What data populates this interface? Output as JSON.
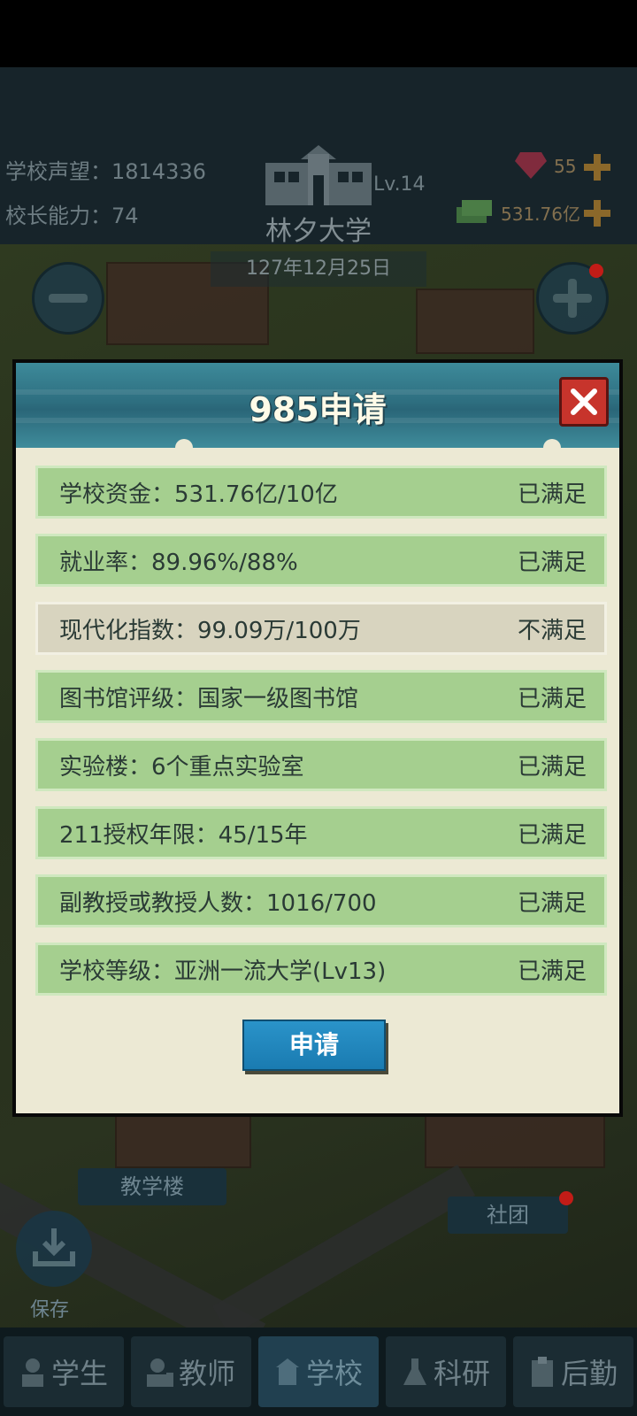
{
  "hud": {
    "prestige": "学校声望：1814336",
    "ability": "校长能力：74",
    "level": "Lv.14",
    "school_name": "林夕大学",
    "gems": "55",
    "money": "531.76亿",
    "date": "127年12月25日"
  },
  "dialog": {
    "title": "985申请",
    "rows": [
      {
        "label": "学校资金：531.76亿/10亿",
        "status": "已满足"
      },
      {
        "label": "就业率：89.96%/88%",
        "status": "已满足"
      },
      {
        "label": "现代化指数：99.09万/100万",
        "status": "不满足"
      },
      {
        "label": "图书馆评级：国家一级图书馆",
        "status": "已满足"
      },
      {
        "label": "实验楼：6个重点实验室",
        "status": "已满足"
      },
      {
        "label": "211授权年限：45/15年",
        "status": "已满足"
      },
      {
        "label": "副教授或教授人数：1016/700",
        "status": "已满足"
      },
      {
        "label": "学校等级：亚洲一流大学(Lv13)",
        "status": "已满足"
      }
    ],
    "apply_label": "申请"
  },
  "map": {
    "teaching_building": "教学楼",
    "club": "社团",
    "save": "保存"
  },
  "nav": {
    "tabs": [
      {
        "label": "学生",
        "icon": "student-icon"
      },
      {
        "label": "教师",
        "icon": "teacher-icon"
      },
      {
        "label": "学校",
        "icon": "school-icon"
      },
      {
        "label": "科研",
        "icon": "flask-icon"
      },
      {
        "label": "后勤",
        "icon": "clipboard-icon"
      }
    ]
  },
  "colors": {
    "met_row": "#a5cf8f",
    "unmet_row": "#d8d4bf",
    "header": "#2e6f80",
    "close": "#c7342c",
    "apply": "#1a7bb1"
  }
}
